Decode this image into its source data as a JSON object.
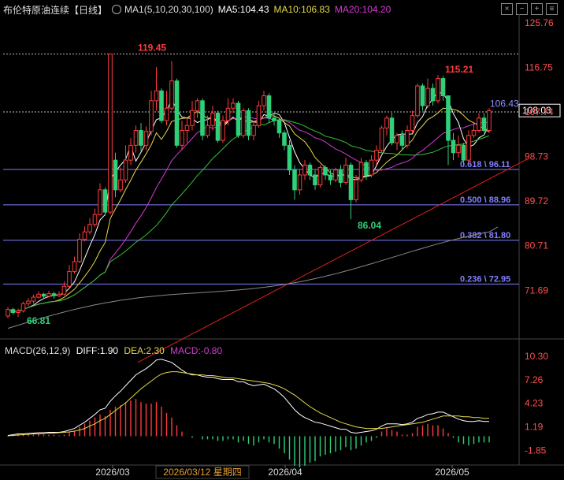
{
  "header": {
    "symbol": "布伦特原油连续",
    "period": "【日线】",
    "ma_set": "MA1(5,10,20,30,100)",
    "ma5": "MA5:104.43",
    "ma10": "MA10:106.83",
    "ma20": "MA20:104.20",
    "toolbar_icons": [
      "close-icon",
      "minus-icon",
      "plus-icon",
      "menu-icon"
    ]
  },
  "colors": {
    "up": "#ff3b3b",
    "down": "#2ed17a",
    "ma5": "#ffffff",
    "ma10": "#e6d84a",
    "ma20": "#d43ad4",
    "ma30": "#36c236",
    "ma100": "#888888",
    "axis_label": "#ff5050",
    "fib": "#8080ff",
    "trend": "#e02020",
    "price_box": "#ffffff",
    "macd_dif": "#ffffff",
    "macd_dea": "#e6d84a",
    "macd_label": "#d43ad4"
  },
  "macd_header": {
    "label": "MACD(26,12,9)",
    "diff": "DIFF:1.90",
    "dea": "DEA:2.30",
    "macd": "MACD:-0.80"
  },
  "chart_data": [
    {
      "type": "candlestick",
      "title": "布伦特原油连续",
      "y_ticks": [
        "125.76",
        "116.75",
        "107.74",
        "98.73",
        "89.72",
        "80.71",
        "71.69"
      ],
      "ylim": [
        62.5,
        127.5
      ],
      "x_ticks": [
        "2026/03",
        "2026/04",
        "2026/05"
      ],
      "crosshair_date": "2026/03/12 星期四",
      "current_price": "108.03",
      "annotations": {
        "high_main": "119.45",
        "high_recent": "115.21",
        "low_mid": "86.04",
        "low_start": "66.81",
        "ma_value": "106.43"
      },
      "fib_levels": [
        {
          "label": "0.618 \\ 96.11",
          "value": 96.11
        },
        {
          "label": "0.500 \\ 88.96",
          "value": 88.96
        },
        {
          "label": "0.382 \\ 81.80",
          "value": 81.8
        },
        {
          "label": "0.236 \\ 72.95",
          "value": 72.95
        }
      ],
      "reference_lines": [
        {
          "value": 119.45
        },
        {
          "value": 107.74
        }
      ],
      "trendline": [
        [
          0,
          60
        ],
        [
          94,
          98.5
        ]
      ],
      "candles": [
        [
          66.5,
          67.8,
          66.0,
          68.3
        ],
        [
          67.8,
          67.2,
          66.8,
          68.2
        ],
        [
          67.2,
          67.5,
          66.3,
          68.0
        ],
        [
          67.5,
          69.0,
          67.2,
          69.4
        ],
        [
          69.0,
          69.5,
          68.5,
          70.1
        ],
        [
          69.5,
          70.3,
          69.0,
          70.8
        ],
        [
          70.3,
          70.9,
          70.0,
          71.5
        ],
        [
          70.9,
          70.5,
          70.0,
          71.2
        ],
        [
          70.5,
          71.0,
          70.2,
          71.6
        ],
        [
          71.0,
          70.6,
          70.0,
          71.4
        ],
        [
          70.6,
          70.9,
          70.3,
          71.5
        ],
        [
          70.9,
          72.5,
          70.6,
          73.5
        ],
        [
          72.5,
          75.5,
          72.2,
          76.8
        ],
        [
          75.5,
          77.5,
          75.0,
          78.5
        ],
        [
          77.5,
          82.0,
          77.2,
          83.2
        ],
        [
          82.0,
          83.5,
          81.6,
          84.6
        ],
        [
          83.5,
          85.0,
          83.0,
          86.3
        ],
        [
          85.0,
          87.0,
          84.5,
          88.2
        ],
        [
          87.0,
          92.0,
          86.8,
          93.3
        ],
        [
          92.0,
          87.5,
          86.8,
          92.5
        ],
        [
          87.5,
          119.45,
          87.0,
          119.45
        ],
        [
          98.0,
          92.0,
          90.5,
          99.5
        ],
        [
          92.0,
          94.0,
          91.5,
          96.5
        ],
        [
          94.0,
          98.0,
          93.4,
          101.0
        ],
        [
          98.0,
          101.0,
          97.0,
          102.5
        ],
        [
          101.0,
          104.0,
          99.5,
          105.0
        ],
        [
          104.0,
          101.0,
          99.8,
          105.5
        ],
        [
          101.0,
          103.8,
          100.0,
          104.8
        ],
        [
          103.8,
          110.0,
          103.0,
          112.0
        ],
        [
          110.0,
          112.0,
          108.0,
          116.8
        ],
        [
          112.0,
          106.0,
          105.5,
          112.5
        ],
        [
          106.0,
          108.5,
          105.0,
          112.0
        ],
        [
          108.5,
          114.0,
          108.0,
          118.0
        ],
        [
          114.0,
          101.0,
          100.5,
          114.5
        ],
        [
          101.0,
          104.0,
          100.0,
          106.0
        ],
        [
          104.0,
          105.0,
          101.5,
          106.5
        ],
        [
          105.0,
          108.0,
          104.0,
          110.0
        ],
        [
          108.0,
          110.0,
          106.5,
          110.5
        ],
        [
          110.0,
          103.0,
          102.0,
          110.5
        ],
        [
          103.0,
          105.0,
          102.5,
          107.0
        ],
        [
          105.0,
          107.5,
          104.0,
          109.0
        ],
        [
          107.5,
          102.0,
          101.5,
          108.0
        ],
        [
          102.0,
          106.0,
          101.5,
          107.0
        ],
        [
          106.0,
          108.5,
          105.0,
          110.5
        ],
        [
          108.5,
          109.5,
          107.5,
          110.5
        ],
        [
          109.5,
          103.0,
          102.5,
          110.0
        ],
        [
          103.0,
          108.0,
          102.5,
          108.5
        ],
        [
          108.0,
          103.0,
          102.0,
          108.5
        ],
        [
          103.0,
          105.0,
          102.0,
          106.0
        ],
        [
          105.0,
          109.0,
          104.5,
          110.0
        ],
        [
          109.0,
          111.0,
          108.0,
          112.0
        ],
        [
          111.0,
          106.5,
          105.5,
          111.5
        ],
        [
          106.5,
          106.0,
          105.0,
          107.5
        ],
        [
          106.0,
          103.5,
          102.5,
          106.5
        ],
        [
          103.5,
          101.0,
          100.0,
          104.0
        ],
        [
          101.0,
          96.0,
          95.0,
          102.0
        ],
        [
          96.0,
          92.0,
          90.0,
          97.0
        ],
        [
          92.0,
          95.0,
          91.0,
          96.0
        ],
        [
          95.0,
          97.0,
          94.0,
          98.0
        ],
        [
          97.0,
          95.0,
          94.0,
          97.5
        ],
        [
          95.0,
          93.0,
          92.0,
          96.0
        ],
        [
          93.0,
          96.5,
          92.5,
          97.0
        ],
        [
          96.5,
          95.0,
          94.0,
          97.0
        ],
        [
          95.0,
          94.0,
          93.0,
          96.0
        ],
        [
          94.0,
          96.0,
          93.5,
          96.5
        ],
        [
          96.0,
          93.5,
          92.5,
          97.0
        ],
        [
          93.5,
          97.0,
          93.0,
          98.5
        ],
        [
          97.0,
          90.0,
          86.04,
          97.5
        ],
        [
          90.0,
          94.0,
          89.5,
          95.0
        ],
        [
          94.0,
          97.5,
          93.5,
          98.5
        ],
        [
          97.5,
          95.0,
          94.0,
          98.0
        ],
        [
          95.0,
          98.0,
          94.5,
          99.0
        ],
        [
          98.0,
          100.0,
          97.0,
          101.0
        ],
        [
          100.0,
          104.5,
          99.5,
          105.0
        ],
        [
          104.5,
          106.5,
          103.0,
          107.0
        ],
        [
          106.5,
          101.5,
          101.0,
          107.5
        ],
        [
          101.5,
          103.0,
          100.0,
          103.5
        ],
        [
          103.0,
          101.0,
          100.0,
          104.0
        ],
        [
          101.0,
          104.0,
          100.5,
          105.0
        ],
        [
          104.0,
          107.0,
          103.5,
          108.0
        ],
        [
          107.0,
          113.0,
          106.5,
          113.5
        ],
        [
          113.0,
          109.0,
          108.0,
          113.5
        ],
        [
          109.0,
          112.5,
          108.5,
          114.5
        ],
        [
          112.5,
          110.0,
          109.0,
          113.5
        ],
        [
          110.0,
          114.5,
          109.5,
          115.21
        ],
        [
          114.5,
          111.0,
          110.0,
          115.0
        ],
        [
          111.0,
          102.0,
          97.0,
          111.0
        ],
        [
          102.0,
          99.5,
          98.0,
          103.5
        ],
        [
          99.5,
          101.0,
          98.5,
          103.0
        ],
        [
          101.0,
          98.0,
          97.0,
          101.5
        ],
        [
          98.0,
          103.0,
          97.5,
          104.0
        ],
        [
          103.0,
          104.0,
          102.5,
          105.5
        ],
        [
          104.0,
          106.5,
          103.5,
          107.5
        ],
        [
          106.5,
          104.0,
          103.5,
          107.5
        ],
        [
          104.0,
          108.0,
          103.5,
          108.5
        ]
      ]
    },
    {
      "type": "macd",
      "y_ticks": [
        "10.30",
        "7.26",
        "4.23",
        "1.19",
        "-1.85"
      ],
      "ylim": [
        -3.2,
        11.0
      ],
      "x_ticks": [
        "2026/03",
        "2026/04",
        "2026/05"
      ],
      "dif": [
        0.1,
        0.2,
        0.3,
        0.3,
        0.35,
        0.4,
        0.45,
        0.45,
        0.5,
        0.5,
        0.5,
        0.6,
        0.8,
        1.0,
        1.4,
        1.8,
        2.3,
        2.8,
        3.4,
        3.6,
        4.5,
        5.2,
        5.8,
        6.5,
        7.2,
        7.9,
        8.3,
        8.7,
        9.2,
        9.8,
        9.9,
        9.7,
        9.5,
        9.0,
        8.5,
        8.1,
        7.9,
        7.9,
        7.7,
        7.6,
        7.6,
        7.4,
        7.3,
        7.3,
        7.3,
        7.0,
        7.0,
        6.7,
        6.5,
        6.6,
        6.7,
        6.4,
        6.1,
        5.6,
        5.0,
        4.2,
        3.4,
        2.8,
        2.4,
        2.1,
        1.8,
        1.7,
        1.5,
        1.3,
        1.1,
        0.9,
        0.9,
        0.5,
        0.4,
        0.5,
        0.6,
        0.7,
        0.9,
        1.3,
        1.6,
        1.6,
        1.6,
        1.5,
        1.6,
        1.8,
        2.3,
        2.5,
        2.8,
        2.9,
        3.1,
        3.1,
        2.8,
        2.5,
        2.2,
        2.0,
        1.9,
        1.9,
        2.0,
        1.9,
        1.9
      ],
      "dea": [
        0.05,
        0.1,
        0.15,
        0.2,
        0.25,
        0.3,
        0.3,
        0.35,
        0.4,
        0.4,
        0.45,
        0.5,
        0.55,
        0.65,
        0.8,
        1.0,
        1.3,
        1.6,
        2.0,
        2.3,
        2.8,
        3.3,
        3.8,
        4.3,
        4.9,
        5.5,
        6.1,
        6.6,
        7.1,
        7.6,
        8.0,
        8.2,
        8.3,
        8.3,
        8.2,
        8.1,
        8.0,
        7.9,
        7.9,
        7.8,
        7.8,
        7.7,
        7.6,
        7.5,
        7.5,
        7.4,
        7.3,
        7.2,
        7.1,
        7.0,
        6.9,
        6.8,
        6.6,
        6.4,
        6.1,
        5.7,
        5.3,
        4.8,
        4.3,
        3.8,
        3.4,
        3.0,
        2.7,
        2.4,
        2.1,
        1.8,
        1.6,
        1.4,
        1.2,
        1.1,
        1.0,
        1.0,
        1.0,
        1.0,
        1.1,
        1.2,
        1.3,
        1.4,
        1.5,
        1.6,
        1.7,
        1.8,
        2.0,
        2.2,
        2.4,
        2.6,
        2.6,
        2.6,
        2.6,
        2.5,
        2.5,
        2.4,
        2.4,
        2.3,
        2.3
      ],
      "hist": [
        0.1,
        0.2,
        0.3,
        0.2,
        0.2,
        0.2,
        0.3,
        0.2,
        0.2,
        0.2,
        0.1,
        0.2,
        0.5,
        0.7,
        1.2,
        1.6,
        2.0,
        2.4,
        2.8,
        2.6,
        3.4,
        3.8,
        4.0,
        4.4,
        4.6,
        4.8,
        4.4,
        4.2,
        4.2,
        4.4,
        3.8,
        3.0,
        2.4,
        1.4,
        0.6,
        0.0,
        -0.2,
        0.0,
        -0.4,
        -0.4,
        -0.4,
        -0.6,
        -0.6,
        -0.4,
        -0.4,
        -0.8,
        -0.6,
        -1.0,
        -1.2,
        -0.8,
        -0.4,
        -0.8,
        -1.0,
        -1.6,
        -2.2,
        -3.0,
        -3.8,
        -4.0,
        -3.8,
        -3.4,
        -3.2,
        -2.6,
        -2.4,
        -2.2,
        -2.0,
        -1.8,
        -1.4,
        -1.8,
        -1.6,
        -1.2,
        -0.8,
        -0.6,
        -0.2,
        0.6,
        1.0,
        0.8,
        0.6,
        0.2,
        0.2,
        0.4,
        1.2,
        1.4,
        1.6,
        1.4,
        1.4,
        1.0,
        0.4,
        -0.2,
        -0.8,
        -1.0,
        -1.2,
        -1.0,
        -0.8,
        -0.8,
        -0.8
      ]
    }
  ]
}
